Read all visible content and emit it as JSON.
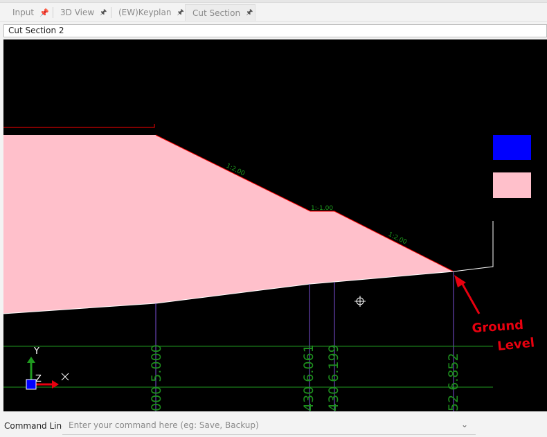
{
  "tabs": [
    {
      "label": "Input",
      "pin": "pinned-icon",
      "active": false
    },
    {
      "label": "3D View",
      "pin": "pin-icon",
      "active": false
    },
    {
      "label": "(EW)Keyplan",
      "pin": "pin-icon",
      "active": false
    },
    {
      "label": "Cut Section",
      "pin": "pin-icon",
      "active": true
    }
  ],
  "document": {
    "title": "Cut Section 2"
  },
  "drawing": {
    "slopes": [
      "1:2.00",
      "1:-1.00",
      "1:2.00"
    ],
    "chainage_labels": [
      "000 5.000",
      "430 6.061",
      "430 6.199",
      "52 6.852"
    ],
    "axes": {
      "y": "Y",
      "z": "Z",
      "x": "X"
    },
    "annotation": {
      "line1": "Ground",
      "line2": "Level"
    },
    "legend_colors": {
      "cut": "#0000ff",
      "fill": "#ffc0cb"
    },
    "fill_color": "#ffc0cb",
    "outline_color": "#ff0000"
  },
  "command": {
    "label": "Command Line:",
    "placeholder": "Enter your command here (eg: Save, Backup)"
  }
}
